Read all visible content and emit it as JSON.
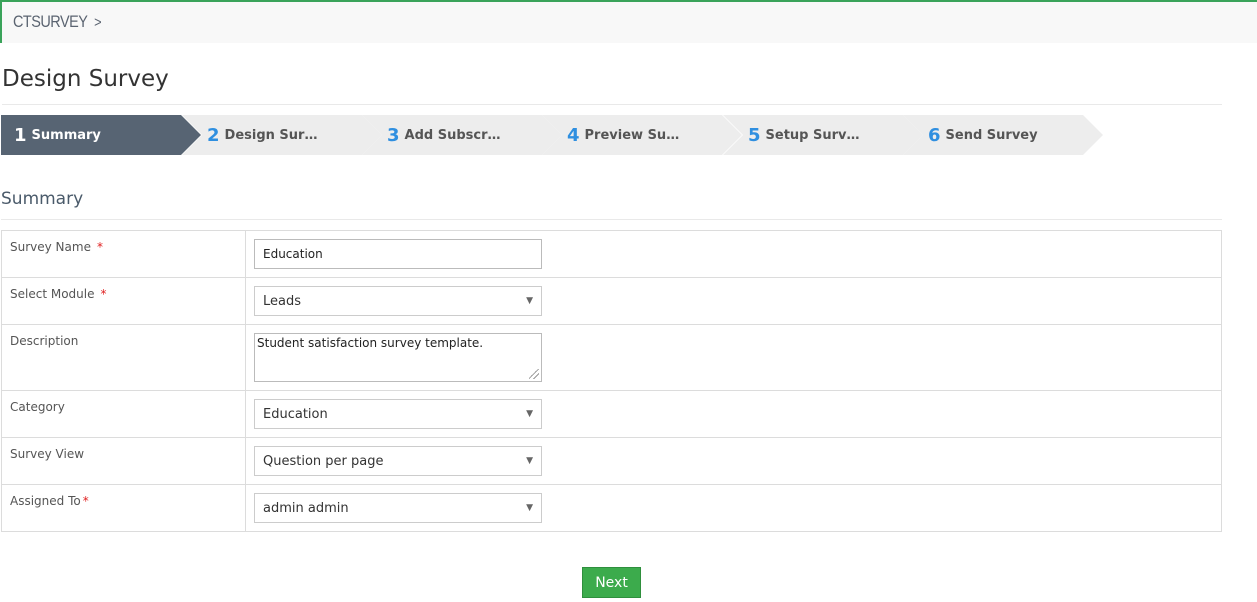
{
  "breadcrumb": {
    "module": "CTSURVEY",
    "separator": ">"
  },
  "page_title": "Design Survey",
  "steps": [
    {
      "num": "1",
      "label": "Summary",
      "active": true
    },
    {
      "num": "2",
      "label": "Design Sur…",
      "active": false
    },
    {
      "num": "3",
      "label": "Add Subscr…",
      "active": false
    },
    {
      "num": "4",
      "label": "Preview Su…",
      "active": false
    },
    {
      "num": "5",
      "label": "Setup Surv…",
      "active": false
    },
    {
      "num": "6",
      "label": "Send Survey",
      "active": false
    }
  ],
  "section_title": "Summary",
  "form": {
    "survey_name": {
      "label": "Survey Name",
      "required": "*",
      "value": "Education"
    },
    "select_module": {
      "label": "Select Module",
      "required": "*",
      "value": "Leads"
    },
    "description": {
      "label": "Description",
      "value": "Student satisfaction survey template."
    },
    "category": {
      "label": "Category",
      "value": "Education"
    },
    "survey_view": {
      "label": "Survey View",
      "value": "Question per page"
    },
    "assigned_to": {
      "label": "Assigned To",
      "required": "*",
      "value": "admin admin"
    }
  },
  "next_button": "Next",
  "colors": {
    "accent_green": "#3cab4c",
    "active_step": "#576473",
    "step_number": "#2f8fe0"
  }
}
